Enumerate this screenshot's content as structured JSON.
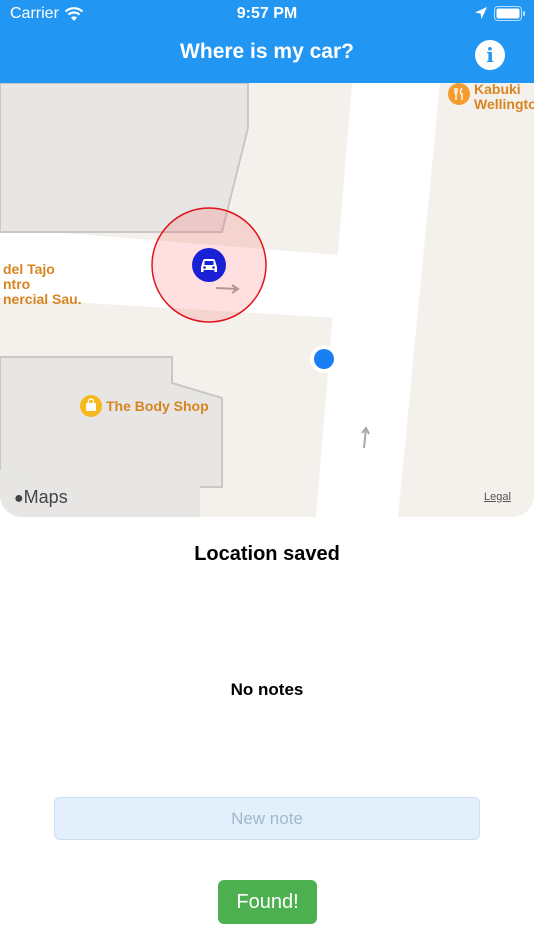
{
  "status_bar": {
    "carrier": "Carrier",
    "time": "9:57 PM",
    "icons": [
      "wifi-icon",
      "location-arrow-icon",
      "battery-icon"
    ]
  },
  "nav": {
    "title": "Where is my car?",
    "info_icon": "info-icon"
  },
  "map": {
    "pois": {
      "kabuki_1": "Kabuki",
      "kabuki_2": "Wellingto",
      "tajo_1": "del Tajo",
      "tajo_2": "ntro",
      "tajo_3": "nercial Sau.",
      "body_shop": "The Body Shop"
    },
    "attribution": "Maps",
    "legal": "Legal",
    "markers": [
      "car-marker-icon",
      "user-location-icon"
    ]
  },
  "main": {
    "status": "Location saved",
    "notes_empty": "No notes",
    "note_placeholder": "New note",
    "note_value": "",
    "found_label": "Found!"
  },
  "colors": {
    "accent": "#2196f3",
    "found": "#4caf50",
    "car_marker": "#1a20d6",
    "user_location": "#1a7ef5",
    "poi": "#d88420"
  }
}
